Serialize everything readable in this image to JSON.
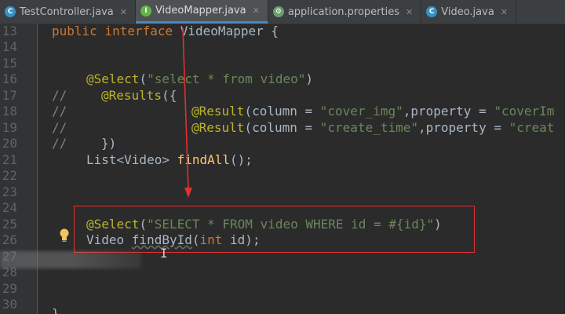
{
  "tabs": [
    {
      "label": "TestController.java",
      "icon": "C",
      "color": "#3592c4",
      "active": false
    },
    {
      "label": "VideoMapper.java",
      "icon": "I",
      "color": "#62b543",
      "active": true
    },
    {
      "label": "application.properties",
      "icon": "⚙",
      "color": "#6a9e6b",
      "active": false
    },
    {
      "label": "Video.java",
      "icon": "C",
      "color": "#3592c4",
      "active": false
    }
  ],
  "line_numbers": [
    "13",
    "14",
    "15",
    "16",
    "17",
    "18",
    "19",
    "20",
    "21",
    "22",
    "23",
    "24",
    "25",
    "26",
    "27",
    "28",
    "29",
    "30"
  ],
  "code": {
    "l13": {
      "kw": "public interface ",
      "rest": "VideoMapper {"
    },
    "l16": {
      "ann": "@Select",
      "p1": "(",
      "str": "\"select * from video\"",
      "p2": ")"
    },
    "l17": {
      "cmt": "//",
      "ann": "@Results",
      "rest": "({"
    },
    "l18": {
      "cmt": "//",
      "ann": "@Result",
      "p1": "(column = ",
      "str1": "\"cover_img\"",
      "p2": ",property = ",
      "str2": "\"coverIm"
    },
    "l19": {
      "cmt": "//",
      "ann": "@Result",
      "p1": "(column = ",
      "str1": "\"create_time\"",
      "p2": ",property = ",
      "str2": "\"creat"
    },
    "l20": {
      "cmt": "//",
      "rest": "})"
    },
    "l21": {
      "p1": "List<Video> ",
      "fn": "findAll",
      "p2": "();"
    },
    "l25": {
      "ann": "@Select",
      "p1": "(",
      "str": "\"SELECT * FROM video WHERE id = #{id}\"",
      "p2": ")"
    },
    "l26": {
      "p1": "Video ",
      "fn": "findById",
      "p2": "(",
      "kw": "int",
      "p3": " id);"
    },
    "l30": {
      "rest": "}"
    }
  }
}
